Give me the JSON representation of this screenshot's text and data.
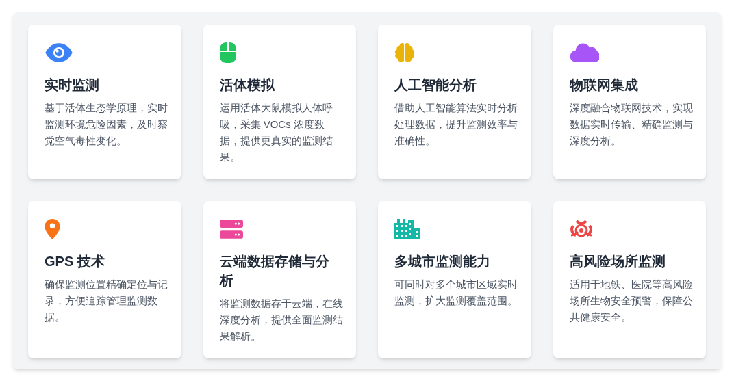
{
  "features": [
    {
      "color": "#3b82f6",
      "title": "实时监测",
      "description": "基于活体生态学原理，实时监测环境危险因素，及时察觉空气毒性变化。"
    },
    {
      "color": "#22c55e",
      "title": "活体模拟",
      "description": "运用活体大鼠模拟人体呼吸，采集 VOCs 浓度数据，提供更真实的监测结果。"
    },
    {
      "color": "#eab308",
      "title": "人工智能分析",
      "description": "借助人工智能算法实时分析处理数据，提升监测效率与准确性。"
    },
    {
      "color": "#a855f7",
      "title": "物联网集成",
      "description": "深度融合物联网技术，实现数据实时传输、精确监测与深度分析。"
    },
    {
      "color": "#f97316",
      "title": "GPS 技术",
      "description": "确保监测位置精确定位与记录，方便追踪管理监测数据。"
    },
    {
      "color": "#ec4899",
      "title": "云端数据存储与分析",
      "description": "将监测数据存于云端，在线深度分析，提供全面监测结果解析。"
    },
    {
      "color": "#14b8a6",
      "title": "多城市监测能力",
      "description": "可同时对多个城市区域实时监测，扩大监测覆盖范围。"
    },
    {
      "color": "#ef4444",
      "title": "高风险场所监测",
      "description": "适用于地铁、医院等高风险场所生物安全预警，保障公共健康安全。"
    }
  ]
}
